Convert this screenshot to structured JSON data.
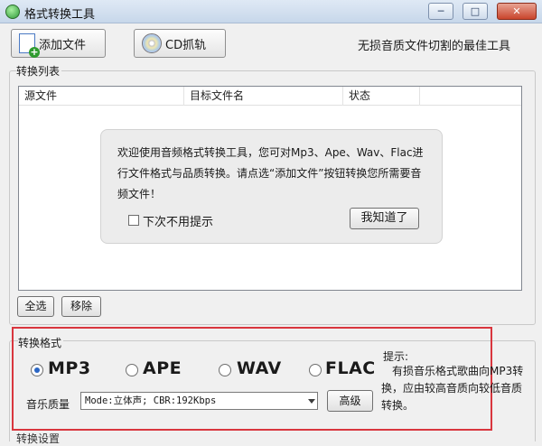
{
  "window": {
    "title": "格式转换工具",
    "minimize_glyph": "─",
    "maximize_glyph": "□",
    "close_glyph": "✕"
  },
  "toolbar": {
    "add_file_label": "添加文件",
    "cd_rip_label": "CD抓轨",
    "slogan": "无损音质文件切割的最佳工具"
  },
  "list": {
    "group_label": "转换列表",
    "columns": [
      "源文件",
      "目标文件名",
      "状态"
    ]
  },
  "welcome": {
    "message": "欢迎使用音频格式转换工具，您可对Mp3、Ape、Wav、Flac进行文件格式与品质转换。请点选“添加文件”按钮转换您所需要音频文件！",
    "checkbox_label": "下次不用提示",
    "checkbox_checked": false,
    "ok_label": "我知道了"
  },
  "list_buttons": {
    "select_all": "全选",
    "remove": "移除"
  },
  "format": {
    "group_label": "转换格式",
    "options": [
      {
        "label": "MP3",
        "selected": true
      },
      {
        "label": "APE",
        "selected": false
      },
      {
        "label": "WAV",
        "selected": false
      },
      {
        "label": "FLAC",
        "selected": false
      }
    ],
    "quality_label": "音乐质量",
    "quality_value": "Mode:立体声; CBR:192Kbps",
    "advanced_label": "高级",
    "hint_title": "提示:",
    "hint_body": "有损音乐格式歌曲向MP3转换，应由较高音质向较低音质转换。"
  },
  "next_section_label": "转换设置",
  "colors": {
    "highlight_border": "#d9363e",
    "radio_selected": "#2b66c4"
  }
}
